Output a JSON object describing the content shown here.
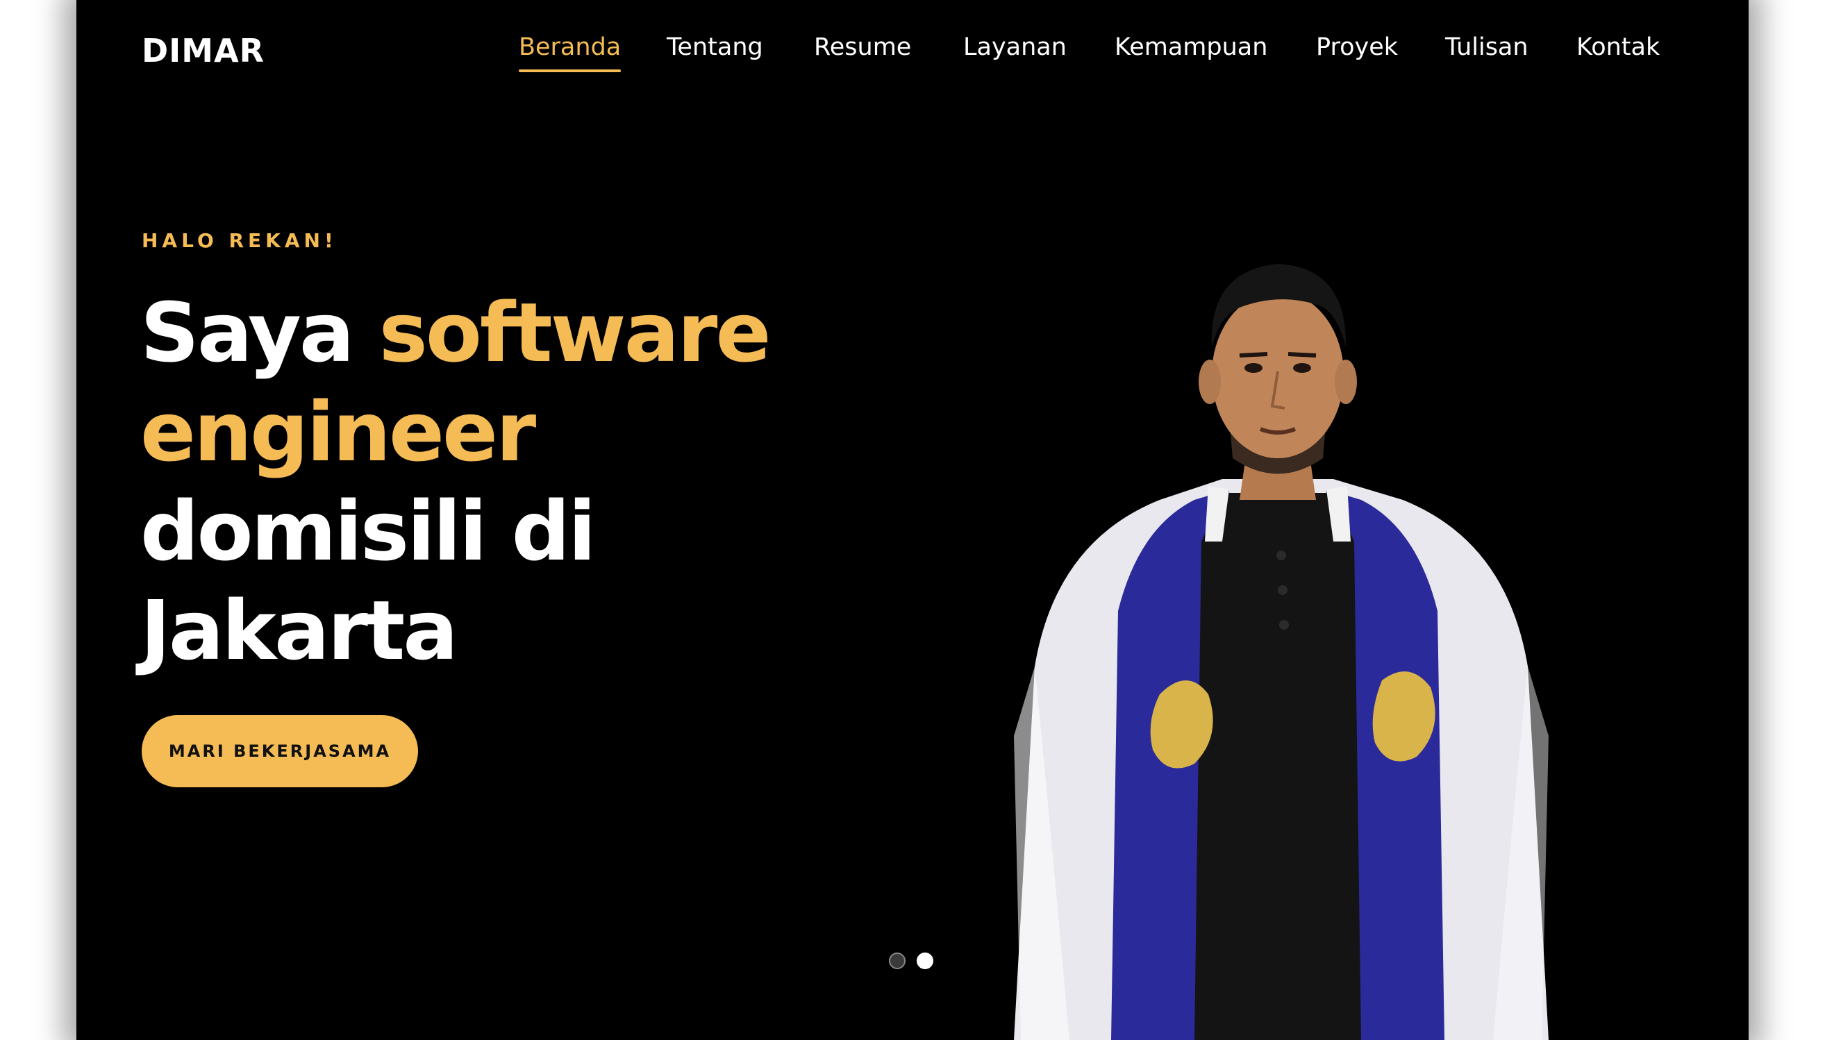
{
  "brand": {
    "name": "DIMAR"
  },
  "nav": {
    "items": [
      {
        "label": "Beranda",
        "active": true
      },
      {
        "label": "Tentang",
        "active": false
      },
      {
        "label": "Resume",
        "active": false
      },
      {
        "label": "Layanan",
        "active": false
      },
      {
        "label": "Kemampuan",
        "active": false
      },
      {
        "label": "Proyek",
        "active": false
      },
      {
        "label": "Tulisan",
        "active": false
      },
      {
        "label": "Kontak",
        "active": false
      }
    ]
  },
  "hero": {
    "eyebrow": "HALO REKAN!",
    "headline_part1": "Saya ",
    "headline_highlight": "software engineer",
    "headline_part2": " domisili di Jakarta",
    "cta_label": "MARI BEKERJASAMA"
  },
  "slider": {
    "slide_count": 2,
    "active_index": 1
  },
  "colors": {
    "accent": "#f5bc55",
    "background": "#000000",
    "text": "#ffffff",
    "jacket_blue": "#2a2a9a"
  }
}
